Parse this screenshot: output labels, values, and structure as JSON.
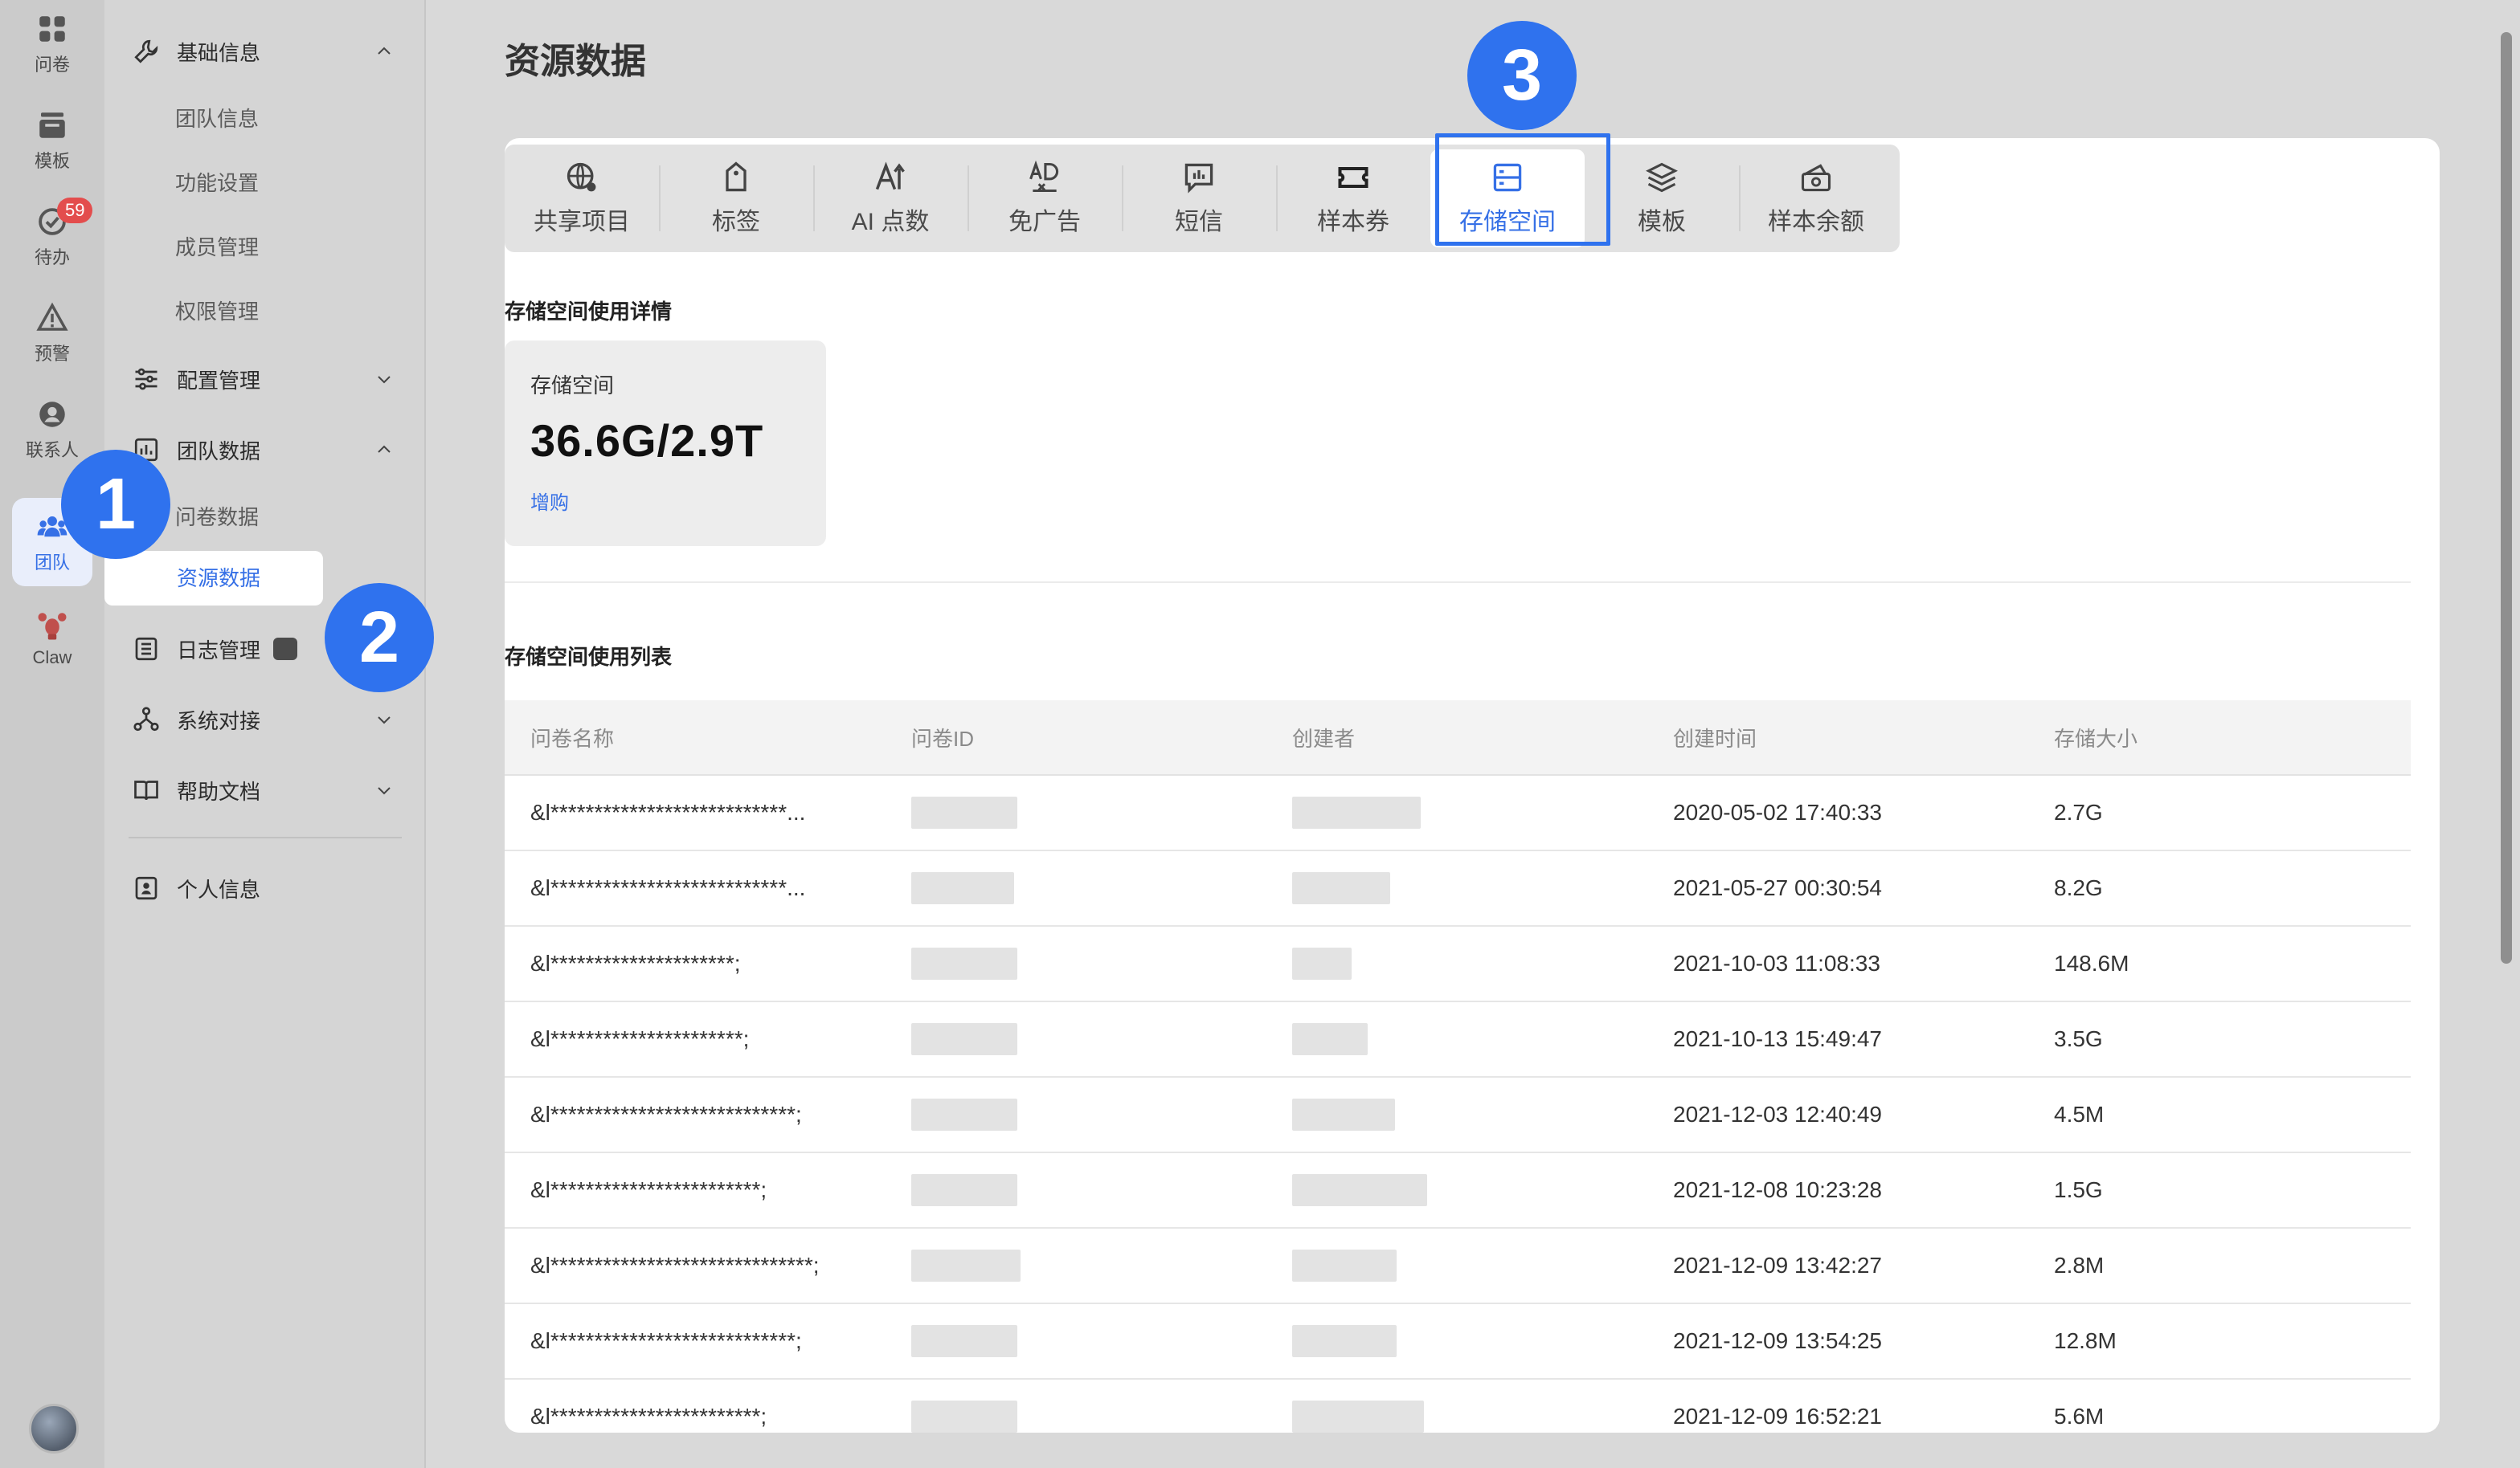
{
  "rail": {
    "items": [
      {
        "label": "问卷",
        "icon": "grid-icon"
      },
      {
        "label": "模板",
        "icon": "template-stack-icon"
      },
      {
        "label": "待办",
        "icon": "todo-check-icon",
        "badge": "59"
      },
      {
        "label": "预警",
        "icon": "warning-icon"
      },
      {
        "label": "联系人",
        "icon": "contact-icon"
      },
      {
        "label": "团队",
        "icon": "team-icon"
      },
      {
        "label": "Claw",
        "icon": "claw-lobster-icon"
      }
    ]
  },
  "nav": {
    "groups": [
      {
        "label": "基础信息",
        "icon": "wrench-icon",
        "expanded": true
      },
      {
        "label": "配置管理",
        "icon": "sliders-icon",
        "expanded": false
      },
      {
        "label": "团队数据",
        "icon": "chart-box-icon",
        "expanded": true
      },
      {
        "label": "日志管理",
        "icon": "log-list-icon"
      },
      {
        "label": "系统对接",
        "icon": "network-icon",
        "expanded": false
      },
      {
        "label": "帮助文档",
        "icon": "book-icon",
        "expanded": false
      },
      {
        "label": "个人信息",
        "icon": "person-card-icon"
      }
    ],
    "basic_subitems": [
      "团队信息",
      "功能设置",
      "成员管理",
      "权限管理"
    ],
    "data_subitems": [
      "问卷数据",
      "资源数据"
    ]
  },
  "page": {
    "title": "资源数据"
  },
  "tabs": [
    {
      "label": "共享项目",
      "icon": "globe-share-icon"
    },
    {
      "label": "标签",
      "icon": "tag-icon"
    },
    {
      "label": "AI 点数",
      "icon": "ai-text-icon"
    },
    {
      "label": "免广告",
      "icon": "no-ad-icon"
    },
    {
      "label": "短信",
      "icon": "sms-chart-icon"
    },
    {
      "label": "样本券",
      "icon": "ticket-icon"
    },
    {
      "label": "存储空间",
      "icon": "storage-icon"
    },
    {
      "label": "模板",
      "icon": "layers-icon"
    },
    {
      "label": "样本余额",
      "icon": "wallet-icon"
    }
  ],
  "active_tab": "存储空间",
  "detail": {
    "section_title": "存储空间使用详情",
    "card_label": "存储空间",
    "card_value": "36.6G/2.9T",
    "card_link": "增购"
  },
  "list": {
    "section_title": "存储空间使用列表",
    "columns": [
      "问卷名称",
      "问卷ID",
      "创建者",
      "创建时间",
      "存储大小"
    ],
    "rows": [
      {
        "name": "&l***************************...",
        "time": "2020-05-02 17:40:33",
        "size": "2.7G"
      },
      {
        "name": "&l***************************...",
        "time": "2021-05-27 00:30:54",
        "size": "8.2G"
      },
      {
        "name": "&l*********************;",
        "time": "2021-10-03 11:08:33",
        "size": "148.6M"
      },
      {
        "name": "&l**********************;",
        "time": "2021-10-13 15:49:47",
        "size": "3.5G"
      },
      {
        "name": "&l****************************;",
        "time": "2021-12-03 12:40:49",
        "size": "4.5M"
      },
      {
        "name": "&l************************;",
        "time": "2021-12-08 10:23:28",
        "size": "1.5G"
      },
      {
        "name": "&l******************************;",
        "time": "2021-12-09 13:42:27",
        "size": "2.8M"
      },
      {
        "name": "&l****************************;",
        "time": "2021-12-09 13:54:25",
        "size": "12.8M"
      },
      {
        "name": "&l************************;",
        "time": "2021-12-09 16:52:21",
        "size": "5.6M"
      }
    ]
  },
  "annotations": {
    "step1": "1",
    "step2": "2",
    "step3": "3"
  },
  "colors": {
    "accent": "#3670e6",
    "callout": "#2f72ee",
    "badge": "#e34d4d"
  }
}
